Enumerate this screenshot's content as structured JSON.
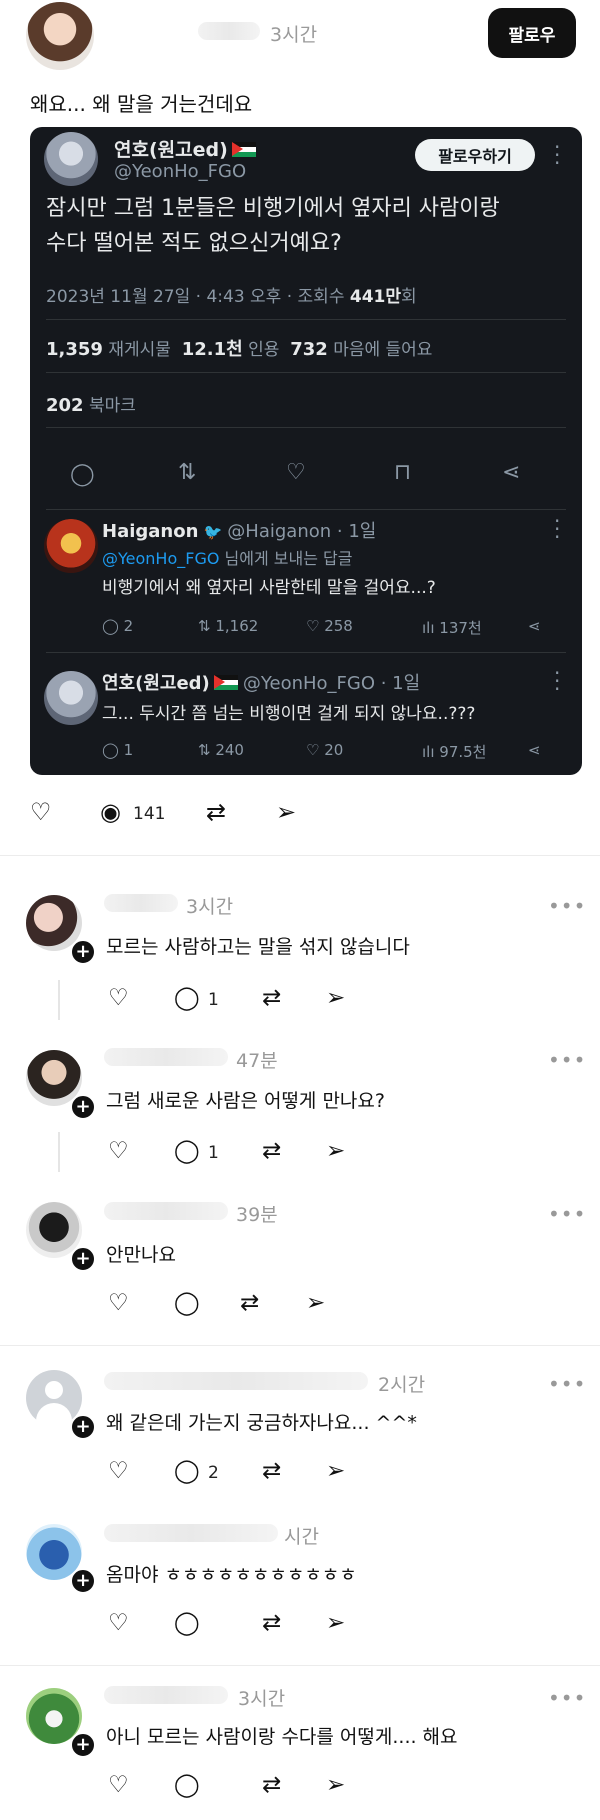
{
  "post": {
    "time": "3시간",
    "follow_label": "팔로우",
    "text": "왜요... 왜 말을 거는건데요",
    "reply_count": "141"
  },
  "tweet": {
    "name": "연호(원고ed)",
    "handle": "@YeonHo_FGO",
    "follow_label": "팔로우하기",
    "body_line1": "잠시만 그럼 1분들은 비행기에서 옆자리 사람이랑",
    "body_line2": "수다 떨어본 적도 없으신거예요?",
    "date": "2023년 11월 27일 · 4:43 오후 · 조회수",
    "views": "441만",
    "views_suffix": "회",
    "retweets": "1,359",
    "retweets_label": "재게시물",
    "quotes": "12.1천",
    "quotes_label": "인용",
    "likes": "732",
    "likes_label": "마음에 들어요",
    "bookmarks": "202",
    "bookmarks_label": "북마크",
    "replies": [
      {
        "name": "Haiganon",
        "handle": "@Haiganon · 1일",
        "to_handle": "@YeonHo_FGO",
        "to_suffix": " 님에게 보내는 답글",
        "body": "비행기에서 왜 옆자리 사람한테 말을 걸어요...?",
        "replies": "2",
        "retweets": "1,162",
        "likes": "258",
        "views": "137천"
      },
      {
        "name": "연호(원고ed)",
        "handle": "@YeonHo_FGO · 1일",
        "body": "그... 두시간 쯤 넘는 비행이면 걸게 되지 않나요..???",
        "replies": "1",
        "retweets": "240",
        "likes": "20",
        "views": "97.5천"
      }
    ]
  },
  "comments": [
    {
      "time": "3시간",
      "text": "모르는 사람하고는 말을 섞지 않습니다",
      "reply_count": "1"
    },
    {
      "time": "47분",
      "text": "그럼 새로운 사람은 어떻게 만나요?",
      "reply_count": "1"
    },
    {
      "time": "39분",
      "text": "안만나요",
      "reply_count": ""
    },
    {
      "time": "2시간",
      "text": "왜 같은데 가는지 궁금하자나요... ^^*",
      "reply_count": "2"
    },
    {
      "time": "시간",
      "text": "옴마야 ㅎㅎㅎㅎㅎㅎㅎㅎㅎㅎㅎ",
      "reply_count": ""
    },
    {
      "time": "3시간",
      "text": "아니 모르는 사람이랑 수다를 어떻게.... 해요",
      "reply_count": ""
    }
  ],
  "icons": {
    "heart": "♡",
    "comment": "◯",
    "repost": "⇄",
    "share": "➢",
    "more": "•••"
  }
}
